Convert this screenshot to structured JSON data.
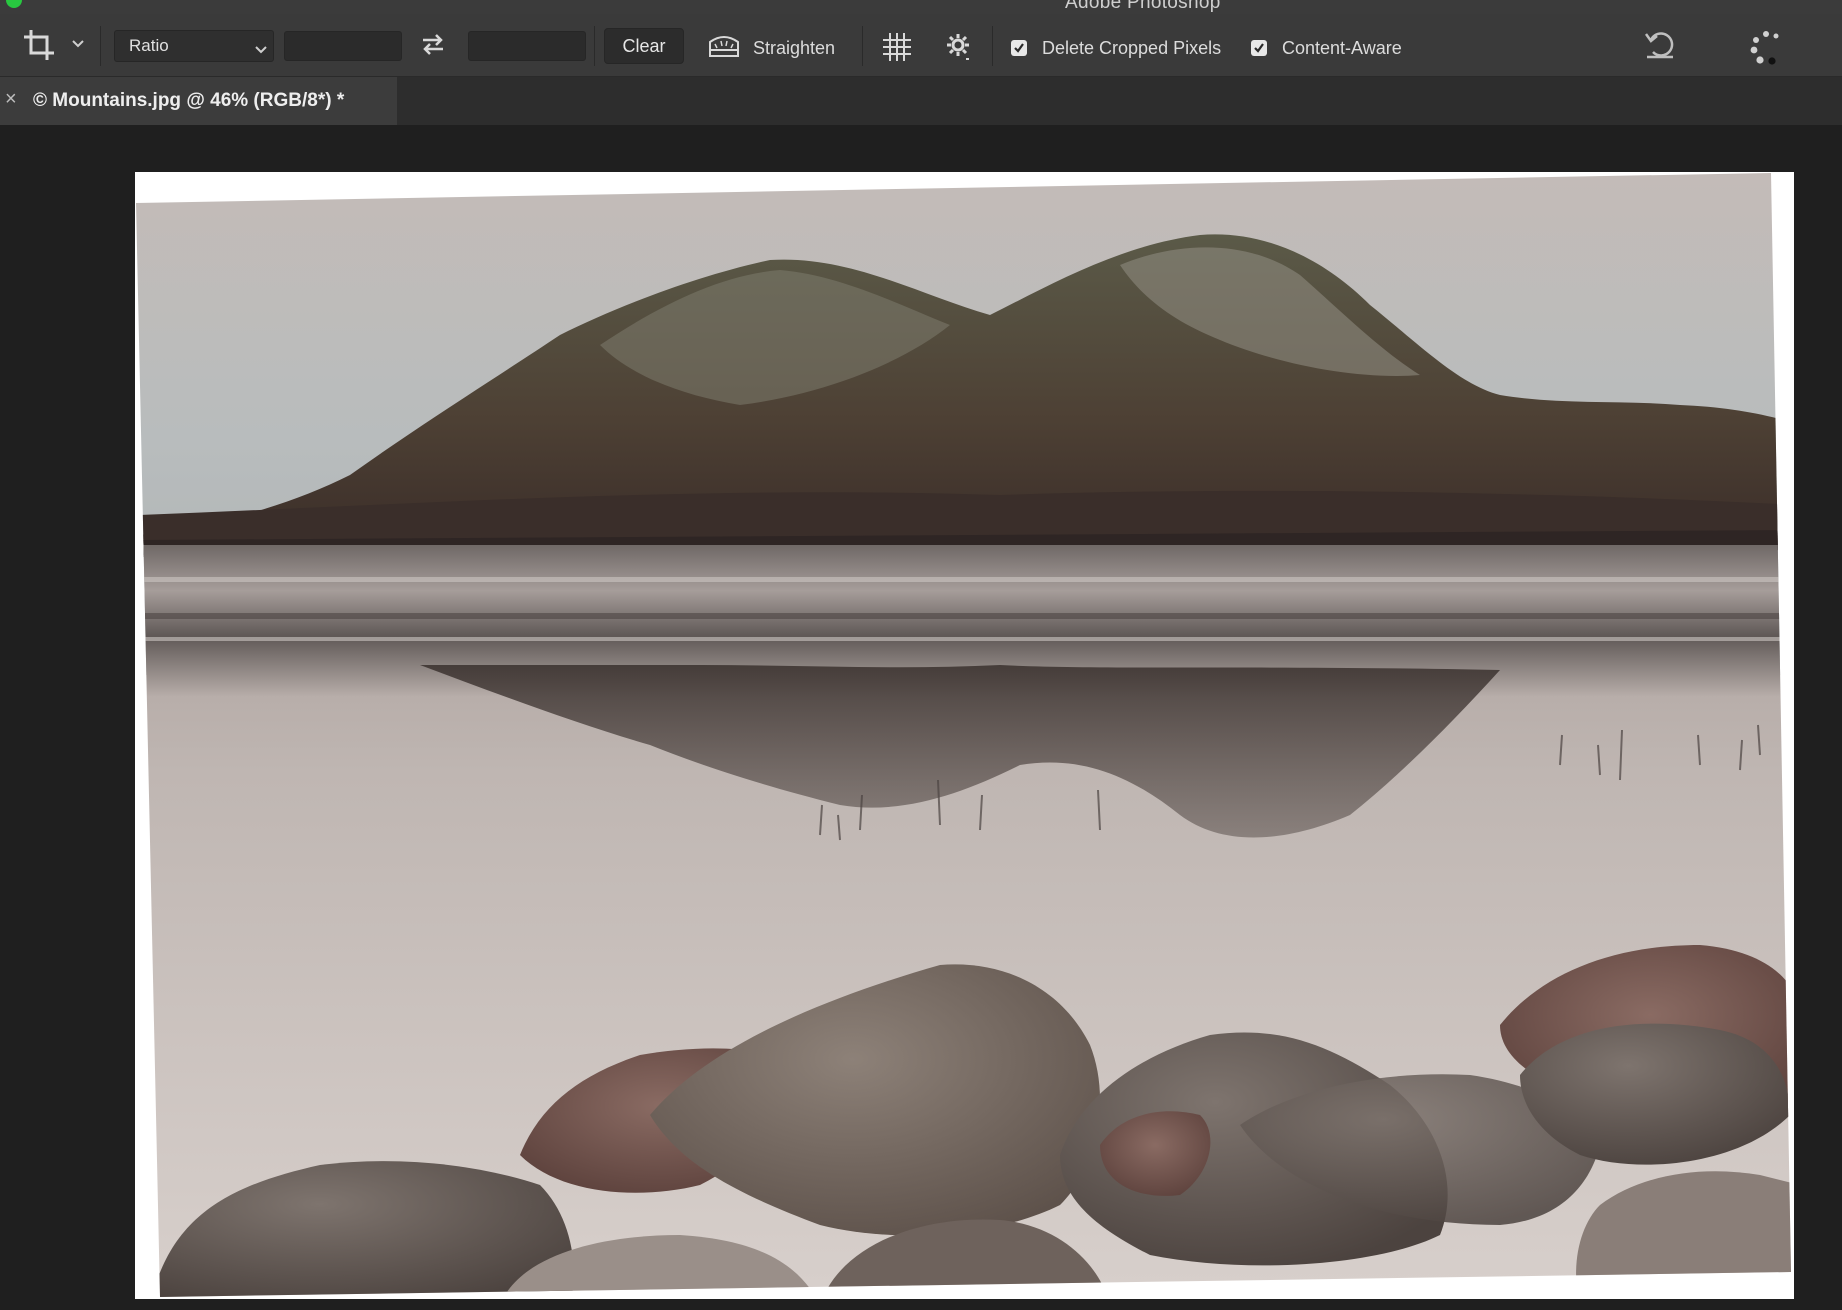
{
  "app": {
    "title": "Adobe Photoshop"
  },
  "options_bar": {
    "crop_tool_icon": "crop-icon",
    "preset_select": {
      "selected": "Ratio"
    },
    "width_field": {
      "value": ""
    },
    "height_field": {
      "value": ""
    },
    "swap_icon": "swap-arrows-icon",
    "clear_label": "Clear",
    "straighten_label": "Straighten",
    "overlay_icon": "grid-overlay-icon",
    "settings_icon": "gear-icon",
    "delete_cropped": {
      "label": "Delete Cropped Pixels",
      "checked": true
    },
    "content_aware": {
      "label": "Content-Aware",
      "checked": true
    },
    "reset_icon": "reset-icon",
    "cancel_icon": "cancel-icon"
  },
  "document_tab": {
    "close_glyph": "×",
    "title": "© Mountains.jpg @ 46% (RGB/8*) *"
  },
  "canvas": {
    "image_description_id": "mountains-lake-photo",
    "zoom_percent": 46
  },
  "colors": {
    "app_background": "#1f1f1f",
    "options_bar": "#3a3a3a",
    "tab_active": "#3c3c3c",
    "checkbox": "#e8e8e8"
  }
}
